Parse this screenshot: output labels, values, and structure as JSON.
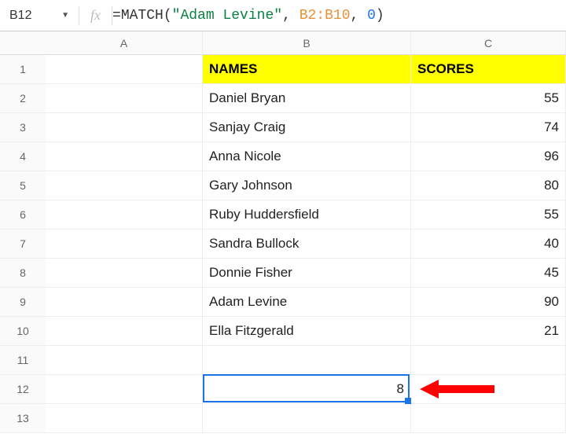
{
  "formula_bar": {
    "cell_ref": "B12",
    "fx_label": "fx",
    "formula_parts": {
      "eq": "=",
      "fn": "MATCH",
      "lp": "(",
      "str": "\"Adam Levine\"",
      "c1": ", ",
      "range": "B2:B10",
      "c2": ", ",
      "num": "0",
      "rp": ")"
    }
  },
  "columns": [
    "A",
    "B",
    "C"
  ],
  "row_count": 13,
  "chart_data": {
    "type": "table",
    "title": "",
    "headers": {
      "B": "NAMES",
      "C": "SCORES"
    },
    "rows": [
      {
        "name": "Daniel Bryan",
        "score": "55"
      },
      {
        "name": "Sanjay Craig",
        "score": "74"
      },
      {
        "name": "Anna Nicole",
        "score": "96"
      },
      {
        "name": "Gary Johnson",
        "score": "80"
      },
      {
        "name": "Ruby Huddersfield",
        "score": "55"
      },
      {
        "name": "Sandra Bullock",
        "score": "40"
      },
      {
        "name": "Donnie Fisher",
        "score": "45"
      },
      {
        "name": "Adam Levine",
        "score": "90"
      },
      {
        "name": "Ella Fitzgerald",
        "score": "21"
      }
    ],
    "result_cell": {
      "ref": "B12",
      "value": "8"
    }
  },
  "selection": {
    "row": 12,
    "col": "B"
  },
  "colors": {
    "highlight": "#ffff00",
    "selection": "#1a73e8",
    "arrow": "#ff0000"
  }
}
